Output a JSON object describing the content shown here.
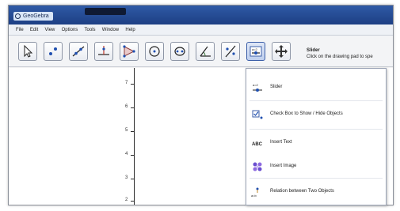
{
  "window": {
    "app_title": "GeoGebra"
  },
  "menu": [
    "File",
    "Edit",
    "View",
    "Options",
    "Tools",
    "Window",
    "Help"
  ],
  "toolbar": {
    "tools": [
      "move-icon",
      "point-icon",
      "line-icon",
      "perpendicular-icon",
      "polygon-icon",
      "circle-icon",
      "ellipse-icon",
      "angle-icon",
      "reflect-icon",
      "slider-icon",
      "move-view-icon"
    ],
    "active_tool": "slider-icon",
    "tooltip_title": "Slider",
    "tooltip_desc": "Click on the drawing pad to spe"
  },
  "canvas": {
    "tick_labels": [
      "7",
      "6",
      "5",
      "4",
      "3",
      "2"
    ]
  },
  "dropdown": {
    "items": [
      {
        "icon": "slider-icon",
        "label": "Slider"
      },
      {
        "icon": "checkbox-icon",
        "label": "Check Box to Show / Hide Objects"
      },
      {
        "icon": "text-icon",
        "label": "Insert Text"
      },
      {
        "icon": "image-icon",
        "label": "Insert Image"
      },
      {
        "icon": "relation-icon",
        "label": "Relation between Two Objects"
      }
    ]
  },
  "colors": {
    "titlebar": "#1d3f84",
    "accent": "#3c5fa8",
    "canvas": "#ffffff"
  }
}
